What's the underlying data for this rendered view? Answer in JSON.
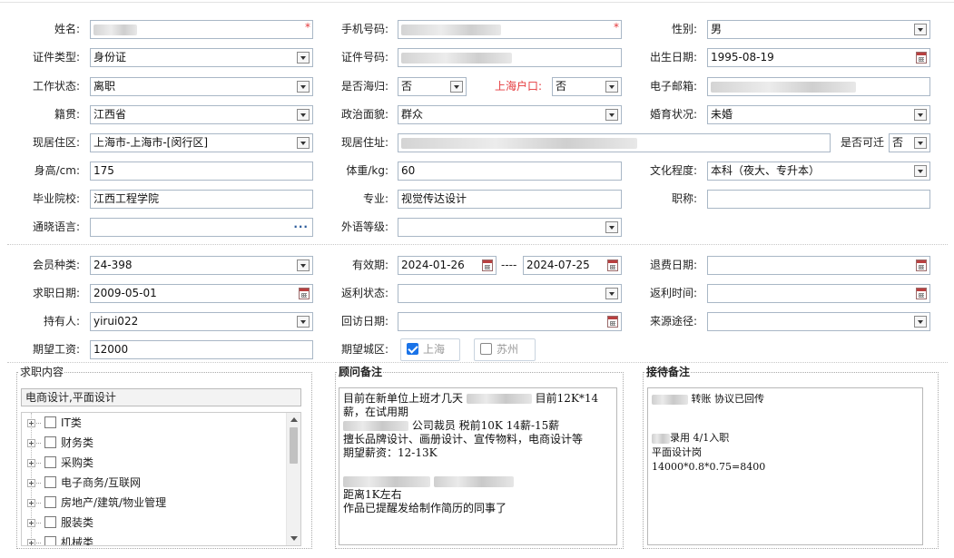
{
  "personal": {
    "name": {
      "label": "姓名:",
      "value": ""
    },
    "phone": {
      "label": "手机号码:",
      "value": ""
    },
    "gender": {
      "label": "性别:",
      "value": "男"
    },
    "id_type": {
      "label": "证件类型:",
      "value": "身份证"
    },
    "id_number": {
      "label": "证件号码:",
      "value": ""
    },
    "birthdate": {
      "label": "出生日期:",
      "value": "1995-08-19"
    },
    "work_status": {
      "label": "工作状态:",
      "value": "离职"
    },
    "returnee": {
      "label": "是否海归:",
      "value": "否"
    },
    "shanghai_hukou": {
      "label": "上海户口:",
      "value": "否"
    },
    "email": {
      "label": "电子邮箱:",
      "value": ""
    },
    "native_place": {
      "label": "籍贯:",
      "value": "江西省"
    },
    "political": {
      "label": "政治面貌:",
      "value": "群众"
    },
    "marital": {
      "label": "婚育状况:",
      "value": "未婚"
    },
    "residence_area": {
      "label": "现居住区:",
      "value": "上海市-上海市-[闵行区]"
    },
    "residence_address": {
      "label": "现居住址:",
      "value": ""
    },
    "relocatable": {
      "label": "是否可迁",
      "value": "否"
    },
    "height": {
      "label": "身高/cm:",
      "value": "175"
    },
    "weight": {
      "label": "体重/kg:",
      "value": "60"
    },
    "education": {
      "label": "文化程度:",
      "value": "本科（夜大、专升本）"
    },
    "school": {
      "label": "毕业院校:",
      "value": "江西工程学院"
    },
    "major": {
      "label": "专业:",
      "value": "视觉传达设计"
    },
    "title": {
      "label": "职称:",
      "value": ""
    },
    "language": {
      "label": "通晓语言:",
      "value": ""
    },
    "foreign_level": {
      "label": "外语等级:",
      "value": ""
    }
  },
  "membership": {
    "member_type": {
      "label": "会员种类:",
      "value": "24-398"
    },
    "valid_period": {
      "label": "有效期:",
      "start": "2024-01-26",
      "separator": "----",
      "end": "2024-07-25"
    },
    "refund_date": {
      "label": "退费日期:",
      "value": ""
    },
    "job_date": {
      "label": "求职日期:",
      "value": "2009-05-01"
    },
    "rebate_status": {
      "label": "返利状态:",
      "value": ""
    },
    "rebate_time": {
      "label": "返利时间:",
      "value": ""
    },
    "holder": {
      "label": "持有人:",
      "value": "yirui022"
    },
    "visit_date": {
      "label": "回访日期:",
      "value": ""
    },
    "source": {
      "label": "来源途径:",
      "value": ""
    },
    "salary": {
      "label": "期望工资:",
      "value": "12000"
    },
    "city": {
      "label": "期望城区:",
      "options": [
        {
          "label": "上海",
          "checked": true
        },
        {
          "label": "苏州",
          "checked": false
        }
      ]
    }
  },
  "job_content": {
    "title": "求职内容",
    "selected": "电商设计,平面设计",
    "tree": [
      "IT类",
      "财务类",
      "采购类",
      "电子商务/互联网",
      "房地产/建筑/物业管理",
      "服装类",
      "机械类"
    ]
  },
  "consultant_notes": {
    "title": "顾问备注",
    "line1_a": "目前在新单位上班才几天",
    "line1_b": "目前12K*14",
    "line2": "薪，在试用期",
    "line3_b": "公司裁员 税前10K  14薪-15薪",
    "line4": "擅长品牌设计、画册设计、宣传物料，电商设计等",
    "line5": "期望薪资：12-13K",
    "line7": "距离1K左右",
    "line8": "作品已提醒发给制作简历的同事了"
  },
  "reception_notes": {
    "title": "接待备注",
    "line1_b": "转账  协议已回传",
    "line2_b": "录用 4/1入职",
    "line3": " 平面设计岗",
    "line4": "14000*0.8*0.75=8400"
  },
  "colors": {
    "required": "#e4393c",
    "check_accent": "#1a73e8",
    "border": "#a9b7c6"
  }
}
